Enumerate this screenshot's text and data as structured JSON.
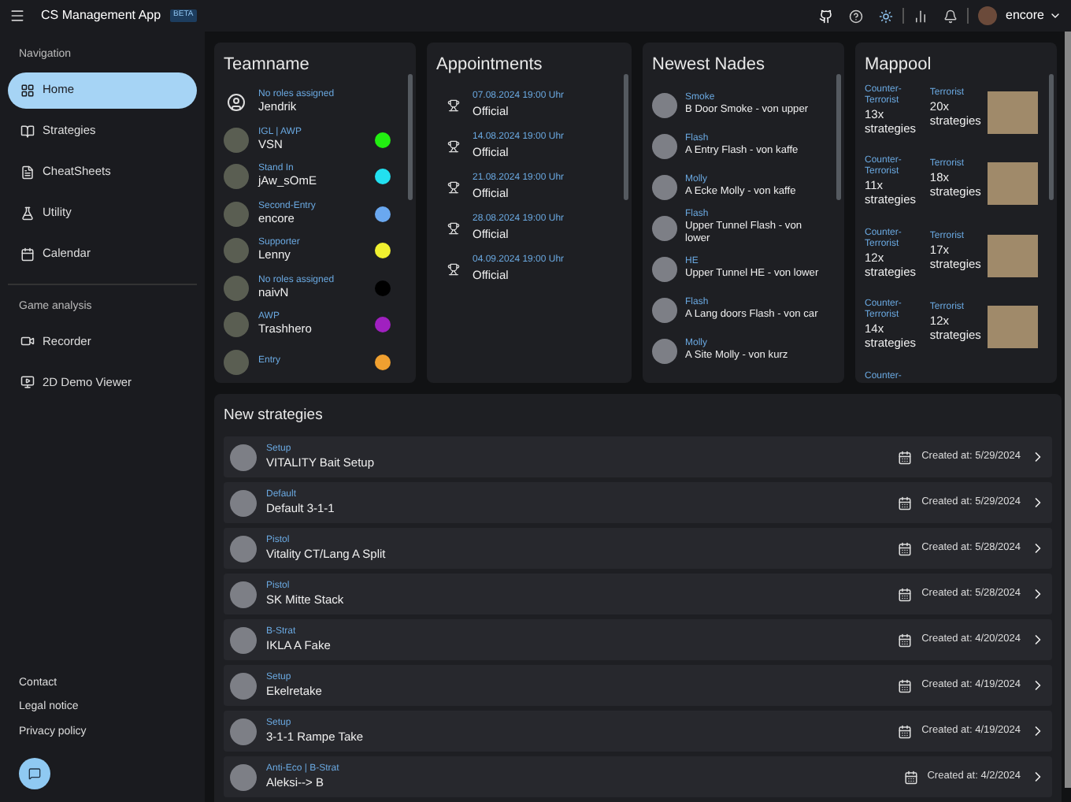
{
  "header": {
    "title": "CS Management App",
    "badge": "BETA",
    "user": "encore"
  },
  "sidebar": {
    "sections": [
      {
        "heading": "Navigation",
        "items": [
          {
            "label": "Home",
            "selected": true
          },
          {
            "label": "Strategies",
            "selected": false
          },
          {
            "label": "CheatSheets",
            "selected": false
          },
          {
            "label": "Utility",
            "selected": false
          },
          {
            "label": "Calendar",
            "selected": false
          }
        ]
      },
      {
        "heading": "Game analysis",
        "items": [
          {
            "label": "Recorder",
            "selected": false
          },
          {
            "label": "2D Demo Viewer",
            "selected": false
          }
        ]
      }
    ],
    "footer_links": [
      "Contact",
      "Legal notice",
      "Privacy policy"
    ]
  },
  "team": {
    "title": "Teamname",
    "members": [
      {
        "role": "No roles assigned",
        "name": "Jendrik",
        "kind": "icon"
      },
      {
        "role": "IGL | AWP",
        "name": "VSN",
        "kind": "photo",
        "color": "#22ee11"
      },
      {
        "role": "Stand In",
        "name": "jAw_sOmE",
        "kind": "photo",
        "color": "#22e0f0"
      },
      {
        "role": "Second-Entry",
        "name": "encore",
        "kind": "photo",
        "color": "#6aa8f0"
      },
      {
        "role": "Supporter",
        "name": "Lenny",
        "kind": "photo",
        "color": "#f0f030"
      },
      {
        "role": "No roles assigned",
        "name": "naivN",
        "kind": "photo",
        "color": "#000000"
      },
      {
        "role": "AWP",
        "name": "Trashhero",
        "kind": "photo",
        "color": "#a020c0"
      },
      {
        "role": "Entry",
        "kind": "photo",
        "color": "#f0a030"
      }
    ]
  },
  "appointments": {
    "title": "Appointments",
    "items": [
      {
        "date": "07.08.2024 19:00 Uhr",
        "type": "Official"
      },
      {
        "date": "14.08.2024 19:00 Uhr",
        "type": "Official"
      },
      {
        "date": "21.08.2024 19:00 Uhr",
        "type": "Official"
      },
      {
        "date": "28.08.2024 19:00 Uhr",
        "type": "Official"
      },
      {
        "date": "04.09.2024 19:00 Uhr",
        "type": "Official"
      }
    ]
  },
  "nades": {
    "title": "Newest Nades",
    "items": [
      {
        "type": "Smoke",
        "name": "B Door Smoke - von upper"
      },
      {
        "type": "Flash",
        "name": "A Entry Flash - von kaffe"
      },
      {
        "type": "Molly",
        "name": "A Ecke Molly - von kaffe"
      },
      {
        "type": "Flash",
        "name": "Upper Tunnel Flash - von lower"
      },
      {
        "type": "HE",
        "name": "Upper Tunnel HE - von lower"
      },
      {
        "type": "Flash",
        "name": "A Lang doors Flash - von car"
      },
      {
        "type": "Molly",
        "name": "A Site Molly - von kurz"
      }
    ]
  },
  "mappool": {
    "title": "Mappool",
    "maps": [
      {
        "ct_label": "Counter-Terrorist",
        "ct_count": "13x",
        "ct_unit": "strategies",
        "t_label": "Terrorist",
        "t_count": "20x",
        "t_unit": "strategies"
      },
      {
        "ct_label": "Counter-Terrorist",
        "ct_count": "11x",
        "ct_unit": "strategies",
        "t_label": "Terrorist",
        "t_count": "18x",
        "t_unit": "strategies"
      },
      {
        "ct_label": "Counter-Terrorist",
        "ct_count": "12x",
        "ct_unit": "strategies",
        "t_label": "Terrorist",
        "t_count": "17x",
        "t_unit": "strategies"
      },
      {
        "ct_label": "Counter-Terrorist",
        "ct_count": "14x",
        "ct_unit": "strategies",
        "t_label": "Terrorist",
        "t_count": "12x",
        "t_unit": "strategies"
      },
      {
        "ct_label": "Counter-"
      }
    ]
  },
  "strategies": {
    "title": "New strategies",
    "items": [
      {
        "tags": "Setup",
        "name": "VITALITY Bait Setup",
        "created": "Created at: 5/29/2024"
      },
      {
        "tags": "Default",
        "name": "Default 3-1-1",
        "created": "Created at: 5/29/2024"
      },
      {
        "tags": "Pistol",
        "name": "Vitality CT/Lang A Split",
        "created": "Created at: 5/28/2024"
      },
      {
        "tags": "Pistol",
        "name": "SK Mitte Stack",
        "created": "Created at: 5/28/2024"
      },
      {
        "tags": "B-Strat",
        "name": "IKLA A Fake",
        "created": "Created at: 4/20/2024"
      },
      {
        "tags": "Setup",
        "name": "Ekelretake",
        "created": "Created at: 4/19/2024"
      },
      {
        "tags": "Setup",
        "name": "3-1-1 Rampe Take",
        "created": "Created at: 4/19/2024"
      },
      {
        "tags": "Anti-Eco | B-Strat",
        "name": "Aleksi--> B",
        "created": "Created at: 4/2/2024"
      }
    ]
  }
}
